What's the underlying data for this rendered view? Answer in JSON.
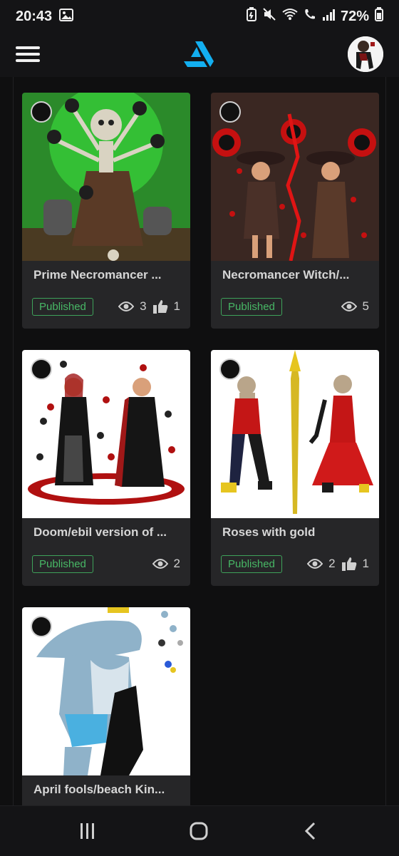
{
  "status_bar": {
    "time": "20:43",
    "battery": "72%"
  },
  "app": {
    "logo_icon": "artstation-logo-icon",
    "menu_icon": "hamburger-menu-icon",
    "accent": "#13aff0"
  },
  "projects": [
    {
      "title": "Prime Necromancer ...",
      "status": "Published",
      "views": "3",
      "likes": "1"
    },
    {
      "title": "Necromancer Witch/...",
      "status": "Published",
      "views": "5",
      "likes": ""
    },
    {
      "title": "Doom/ebil version of ...",
      "status": "Published",
      "views": "2",
      "likes": ""
    },
    {
      "title": "Roses with gold",
      "status": "Published",
      "views": "2",
      "likes": "1"
    },
    {
      "title": "April fools/beach Kin...",
      "status": "",
      "views": "",
      "likes": ""
    }
  ],
  "colors": {
    "published_green": "#48b866",
    "card_bg": "#262628"
  }
}
